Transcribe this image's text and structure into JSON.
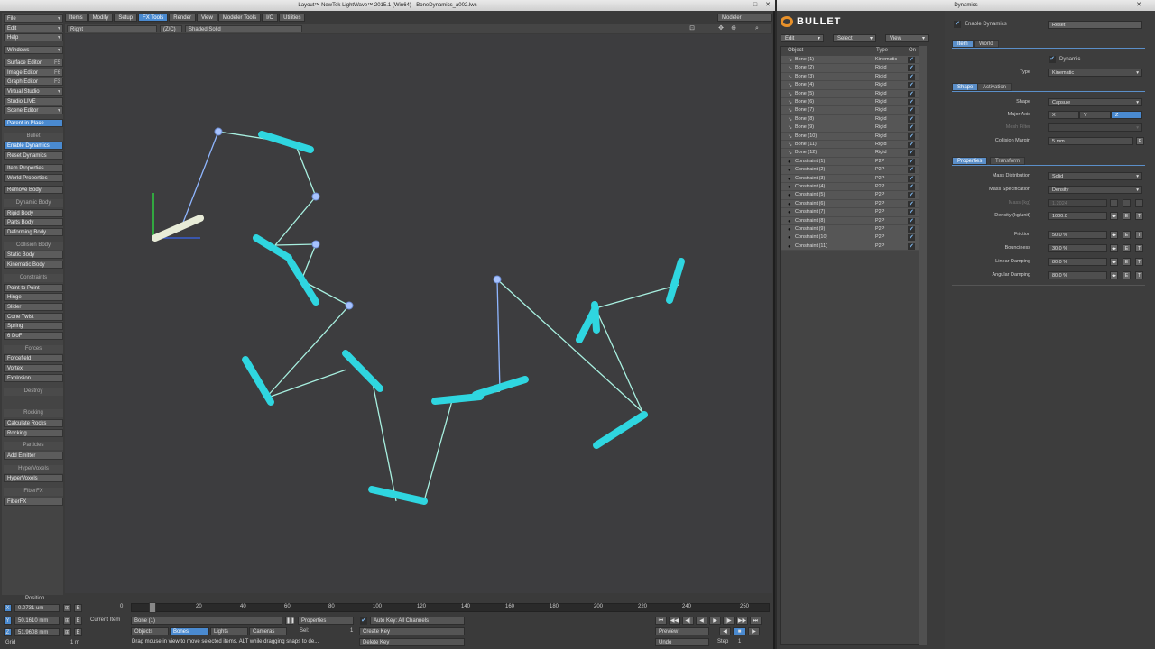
{
  "left_window": {
    "title": "Layout™ NewTek LightWave™ 2015.1 (Win64) - BoneDynamics_a002.lws",
    "menu_tabs": [
      "Items",
      "Modify",
      "Setup",
      "FX Tools",
      "Render",
      "View",
      "Modeler Tools",
      "I/O",
      "Utilities"
    ],
    "modeler_btn": "Modeler",
    "sidebar": {
      "top": [
        {
          "label": "File",
          "sc": "▾"
        },
        {
          "label": "Edit",
          "sc": "▾"
        },
        {
          "label": "Help",
          "sc": "▾"
        },
        {
          "label": "Windows",
          "sc": "▾"
        },
        {
          "label": "Surface Editor",
          "sc": "F5"
        },
        {
          "label": "Image Editor",
          "sc": "F6"
        },
        {
          "label": "Graph Editor",
          "sc": "F3"
        },
        {
          "label": "Virtual Studio",
          "sc": "▾"
        },
        {
          "label": "Studio LIVE",
          "sc": ""
        },
        {
          "label": "Scene Editor",
          "sc": "▾"
        },
        {
          "label": "Parent in Place",
          "sc": ""
        }
      ],
      "bullet_hdr": "Bullet",
      "bullet": [
        "Enable Dynamics",
        "Reset Dynamics",
        "Item Properties",
        "World Properties",
        "Remove Body"
      ],
      "dyn_hdr": "Dynamic Body",
      "dyn": [
        "Rigid Body",
        "Parts Body",
        "Deforming Body"
      ],
      "col_hdr": "Collision Body",
      "col": [
        "Static Body",
        "Kinematic Body"
      ],
      "con_hdr": "Constraints",
      "con": [
        "Point to Point",
        "Hinge",
        "Slider",
        "Cone Twist",
        "Spring",
        "6 DoF"
      ],
      "forces_hdr": "Forces",
      "forces": [
        "Forcefield",
        "Vortex",
        "Explosion"
      ],
      "destroy_hdr": "Destroy",
      "rocks_hdr": "Rocking",
      "rocks": [
        "Calculate Rocks",
        "Rocking"
      ],
      "particles_hdr": "Particles",
      "particles": [
        "Add Emitter"
      ],
      "hv_hdr": "HyperVoxels",
      "hv": [
        "HyperVoxels"
      ],
      "fiber_hdr": "FiberFX",
      "fiber": [
        "FiberFX"
      ]
    },
    "viewport_bar": {
      "view": "Right",
      "zoom": "(Z/C)",
      "shading": "Shaded Solid"
    },
    "bottom": {
      "position_label": "Position",
      "x": "0.0731 um",
      "y": "50.1610 mm",
      "z": "51.9608 mm",
      "grid_label": "Grid",
      "grid_val": "1 m",
      "ticks": [
        "0",
        "20",
        "40",
        "60",
        "80",
        "100",
        "120",
        "140",
        "160",
        "180",
        "200",
        "220",
        "240",
        "250"
      ],
      "current_item_label": "Current Item",
      "current_item": "Bone (1)",
      "objects": "Objects",
      "bones": "Bones",
      "lights": "Lights",
      "cameras": "Cameras",
      "properties": "Properties",
      "sel_label": "Sel:",
      "sel_val": "1",
      "auto_key": "Auto Key: All Channels",
      "create_key": "Create Key",
      "delete_key": "Delete Key",
      "preview": "Preview",
      "undo": "Undo",
      "step_label": "Step",
      "step_val": "1",
      "status": "Drag mouse in view to move selected items. ALT while dragging snaps to de..."
    }
  },
  "right_window": {
    "title": "Dynamics",
    "logo": "BULLET",
    "menus": [
      "Edit",
      "Select",
      "View"
    ],
    "list_headers": {
      "object": "Object",
      "type": "Type",
      "on": "On"
    },
    "objects": [
      {
        "name": "Bone (1)",
        "type": "Kinematic",
        "con": false
      },
      {
        "name": "Bone (2)",
        "type": "Rigid",
        "con": false
      },
      {
        "name": "Bone (3)",
        "type": "Rigid",
        "con": false
      },
      {
        "name": "Bone (4)",
        "type": "Rigid",
        "con": false
      },
      {
        "name": "Bone (5)",
        "type": "Rigid",
        "con": false
      },
      {
        "name": "Bone (6)",
        "type": "Rigid",
        "con": false
      },
      {
        "name": "Bone (7)",
        "type": "Rigid",
        "con": false
      },
      {
        "name": "Bone (8)",
        "type": "Rigid",
        "con": false
      },
      {
        "name": "Bone (9)",
        "type": "Rigid",
        "con": false
      },
      {
        "name": "Bone (10)",
        "type": "Rigid",
        "con": false
      },
      {
        "name": "Bone (11)",
        "type": "Rigid",
        "con": false
      },
      {
        "name": "Bone (12)",
        "type": "Rigid",
        "con": false
      },
      {
        "name": "Constraint (1)",
        "type": "P2P",
        "con": true
      },
      {
        "name": "Constraint (2)",
        "type": "P2P",
        "con": true
      },
      {
        "name": "Constraint (3)",
        "type": "P2P",
        "con": true
      },
      {
        "name": "Constraint (4)",
        "type": "P2P",
        "con": true
      },
      {
        "name": "Constraint (5)",
        "type": "P2P",
        "con": true
      },
      {
        "name": "Constraint (6)",
        "type": "P2P",
        "con": true
      },
      {
        "name": "Constraint (7)",
        "type": "P2P",
        "con": true
      },
      {
        "name": "Constraint (8)",
        "type": "P2P",
        "con": true
      },
      {
        "name": "Constraint (9)",
        "type": "P2P",
        "con": true
      },
      {
        "name": "Constraint (10)",
        "type": "P2P",
        "con": true
      },
      {
        "name": "Constraint (11)",
        "type": "P2P",
        "con": true
      }
    ],
    "props": {
      "enable_dynamics": "Enable Dynamics",
      "reset": "Reset",
      "tab_item": "Item",
      "tab_world": "World",
      "dynamic": "Dynamic",
      "type_label": "Type",
      "type_val": "Kinematic",
      "tab_shape": "Shape",
      "tab_activation": "Activation",
      "shape_label": "Shape",
      "shape_val": "Capsule",
      "major_axis_label": "Major Axis",
      "axis_x": "X",
      "axis_y": "Y",
      "axis_z": "Z",
      "mesh_filter_label": "Mesh Filter",
      "collision_margin_label": "Collision Margin",
      "collision_margin_val": "5 mm",
      "tab_properties": "Properties",
      "tab_transform": "Transform",
      "mass_dist_label": "Mass Distribution",
      "mass_dist_val": "Solid",
      "mass_spec_label": "Mass Specification",
      "mass_spec_val": "Density",
      "mass_label": "Mass (kg)",
      "mass_val": "1.2024",
      "density_label": "Density (kg/unit)",
      "density_val": "1000.0",
      "friction_label": "Friction",
      "friction_val": "50.0 %",
      "bounciness_label": "Bounciness",
      "bounciness_val": "30.0 %",
      "lin_damp_label": "Linear Damping",
      "lin_damp_val": "80.0 %",
      "ang_damp_label": "Angular Damping",
      "ang_damp_val": "80.0 %",
      "btn_e": "E",
      "btn_t": "T"
    }
  },
  "colors": {
    "accent": "#4a8ad0",
    "bone": "#2fd6e0",
    "joint": "#8fb6ff",
    "link": "#a8f0e0"
  }
}
